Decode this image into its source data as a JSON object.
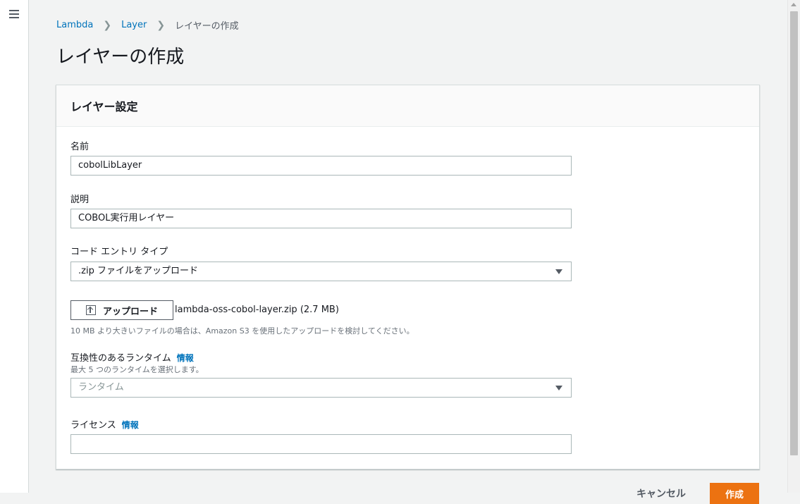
{
  "breadcrumb": {
    "items": [
      "Lambda",
      "Layer"
    ],
    "current": "レイヤーの作成"
  },
  "page": {
    "title": "レイヤーの作成"
  },
  "panel": {
    "title": "レイヤー設定",
    "name": {
      "label": "名前",
      "value": "cobolLibLayer"
    },
    "description": {
      "label": "説明",
      "value": "COBOL実行用レイヤー"
    },
    "code_entry": {
      "label": "コード エントリ タイプ",
      "value": ".zip ファイルをアップロード"
    },
    "upload": {
      "button_label": "アップロード",
      "file_name": "lambda-oss-cobol-layer.zip (2.7 MB)",
      "hint": "10 MB より大きいファイルの場合は、Amazon S3 を使用したアップロードを検討してください。"
    },
    "runtimes": {
      "label": "互換性のあるランタイム",
      "info": "情報",
      "hint": "最大 5 つのランタイムを選択します。",
      "placeholder": "ランタイム"
    },
    "license": {
      "label": "ライセンス",
      "info": "情報",
      "value": ""
    }
  },
  "footer": {
    "cancel_label": "キャンセル",
    "create_label": "作成"
  },
  "colors": {
    "accent": "#ec7211",
    "link": "#0073bb"
  }
}
